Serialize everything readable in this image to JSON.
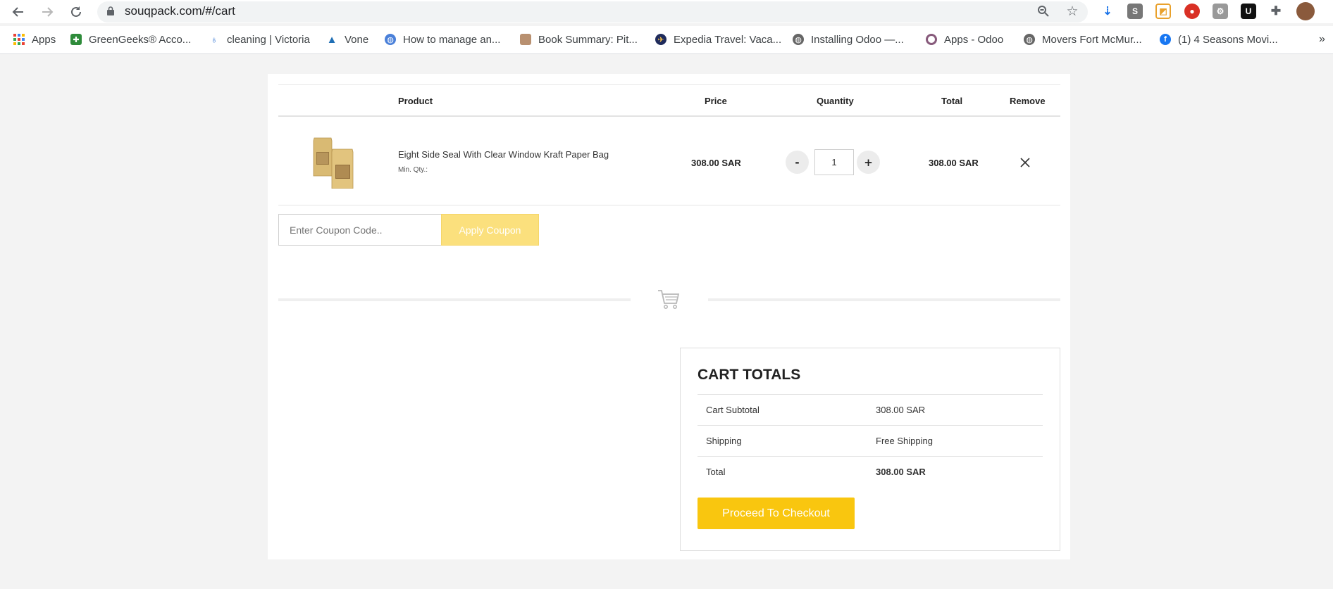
{
  "browser": {
    "url": "souqpack.com/#/cart",
    "bookmarks": [
      {
        "label": "Apps",
        "icon": "apps-grid-icon"
      },
      {
        "label": "GreenGeeks® Acco...",
        "icon": "greengeeks-icon"
      },
      {
        "label": "cleaning | Victoria",
        "icon": "cleaning-icon"
      },
      {
        "label": "Vone",
        "icon": "vone-icon"
      },
      {
        "label": "How to manage an...",
        "icon": "globe-icon"
      },
      {
        "label": "Book Summary: Pit...",
        "icon": "book-icon"
      },
      {
        "label": "Expedia Travel: Vaca...",
        "icon": "expedia-icon"
      },
      {
        "label": "Installing Odoo —...",
        "icon": "globe-icon"
      },
      {
        "label": "Apps - Odoo",
        "icon": "odoo-icon"
      },
      {
        "label": "Movers Fort McMur...",
        "icon": "globe-icon"
      },
      {
        "label": "(1) 4 Seasons Movi...",
        "icon": "facebook-icon"
      }
    ]
  },
  "cart": {
    "headers": {
      "product": "Product",
      "price": "Price",
      "quantity": "Quantity",
      "total": "Total",
      "remove": "Remove"
    },
    "items": [
      {
        "name": "Eight Side Seal With Clear Window Kraft Paper Bag",
        "min_qty": "Min. Qty.:",
        "price": "308.00 SAR",
        "quantity": "1",
        "total": "308.00 SAR",
        "decrement": "-",
        "increment": "+"
      }
    ],
    "coupon": {
      "placeholder": "Enter Coupon Code..",
      "button": "Apply Coupon"
    }
  },
  "totals": {
    "title": "CART TOTALS",
    "rows": [
      {
        "label": "Cart Subtotal",
        "value": "308.00 SAR"
      },
      {
        "label": "Shipping",
        "value": "Free Shipping"
      },
      {
        "label": "Total",
        "value": "308.00 SAR"
      }
    ],
    "checkout": "Proceed To Checkout"
  },
  "colors": {
    "accent": "#f9c60f",
    "accent_light": "#fbe07d",
    "page_bg": "#f3f3f3"
  }
}
